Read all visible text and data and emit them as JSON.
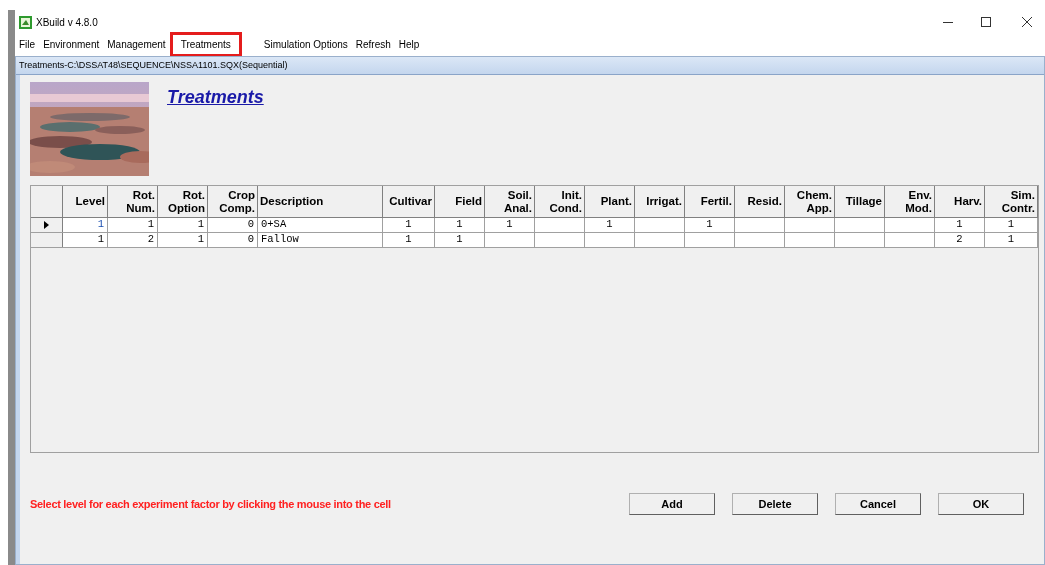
{
  "window": {
    "title": "XBuild v 4.8.0"
  },
  "menu": [
    {
      "label": "File",
      "highlighted": false
    },
    {
      "label": "Environment",
      "highlighted": false
    },
    {
      "label": "Management",
      "highlighted": false
    },
    {
      "label": "Treatments",
      "highlighted": true
    },
    {
      "label": "Simulation Options",
      "highlighted": false
    },
    {
      "label": "Refresh",
      "highlighted": false
    },
    {
      "label": "Help",
      "highlighted": false
    }
  ],
  "child_window": {
    "title": "Treatments-C:\\DSSAT48\\SEQUENCE\\NSSA1101.SQX(Sequential)"
  },
  "heading": "Treatments",
  "table": {
    "columns": [
      "Level",
      "Rot.\nNum.",
      "Rot.\nOption",
      "Crop\nComp.",
      "Description",
      "Cultivar",
      "Field",
      "Soil.\nAnal.",
      "Init.\nCond.",
      "Plant.",
      "Irrigat.",
      "Fertil.",
      "Resid.",
      "Chem.\nApp.",
      "Tillage",
      "Env.\nMod.",
      "Harv.",
      "Sim.\nContr."
    ],
    "rows": [
      {
        "selected": true,
        "cells": [
          "1",
          "1",
          "1",
          "0",
          "0+SA",
          "1",
          "1",
          "1",
          "",
          "1",
          "",
          "1",
          "",
          "",
          "",
          "",
          "1",
          "1"
        ]
      },
      {
        "selected": false,
        "cells": [
          "1",
          "2",
          "1",
          "0",
          "Fallow",
          "1",
          "1",
          "",
          "",
          "",
          "",
          "",
          "",
          "",
          "",
          "",
          "2",
          "1"
        ]
      }
    ]
  },
  "status_message": "Select level for each experiment factor by clicking the mouse into the cell",
  "buttons": [
    "Add",
    "Delete",
    "Cancel",
    "OK"
  ]
}
